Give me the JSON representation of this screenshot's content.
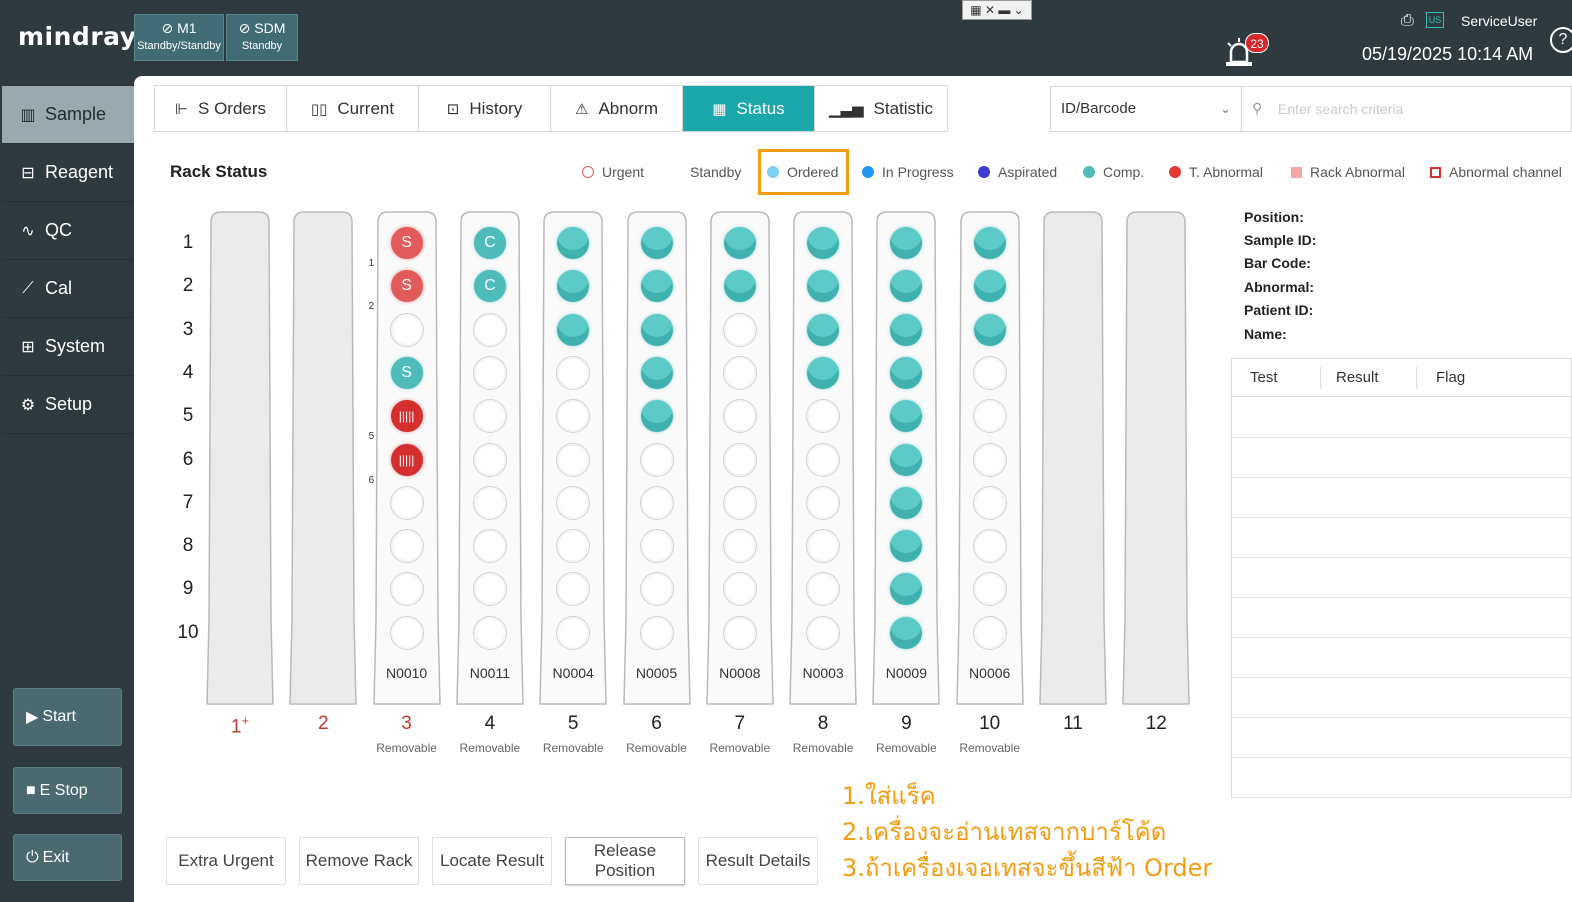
{
  "brand": "mindray",
  "modules": [
    {
      "name": "M1",
      "state": "Standby/Standby"
    },
    {
      "name": "SDM",
      "state": "Standby"
    }
  ],
  "header": {
    "alarm_count": "23",
    "lang_badge": "US",
    "user": "ServiceUser",
    "datetime": "05/19/2025 10:14 AM",
    "help": "?",
    "mini_toolbar": "▦ ✕ ▬ ⌄"
  },
  "sidebar": {
    "items": [
      {
        "label": "Sample",
        "icon": "sample-tubes-icon",
        "active": true
      },
      {
        "label": "Reagent",
        "icon": "reagent-bottle-icon"
      },
      {
        "label": "QC",
        "icon": "qc-chart-icon"
      },
      {
        "label": "Cal",
        "icon": "calibration-icon"
      },
      {
        "label": "System",
        "icon": "system-icon"
      },
      {
        "label": "Setup",
        "icon": "gear-icon"
      }
    ],
    "start": "Start",
    "estop": "E Stop",
    "exit": "Exit"
  },
  "tabs": [
    {
      "label": "S Orders",
      "icon": "sample-order-icon"
    },
    {
      "label": "Current",
      "icon": "tubes-icon"
    },
    {
      "label": "History",
      "icon": "history-icon"
    },
    {
      "label": "Abnorm",
      "icon": "warning-icon"
    },
    {
      "label": "Status",
      "icon": "rack-icon",
      "active": true
    },
    {
      "label": "Statistic",
      "icon": "bar-chart-icon"
    }
  ],
  "search": {
    "type_value": "ID/Barcode",
    "placeholder": "Enter search criteria"
  },
  "rack_status_title": "Rack Status",
  "legend": [
    {
      "label": "Urgent",
      "color": "#e35a5a",
      "style": "ring"
    },
    {
      "label": "Standby",
      "color": "#ffffff",
      "style": "none"
    },
    {
      "label": "Ordered",
      "color": "#7ecff2",
      "style": "dot"
    },
    {
      "label": "In Progress",
      "color": "#2196f3",
      "style": "dot"
    },
    {
      "label": "Aspirated",
      "color": "#3b3bd1",
      "style": "dot"
    },
    {
      "label": "Comp.",
      "color": "#4fbcbc",
      "style": "dot"
    },
    {
      "label": "T. Abnormal",
      "color": "#e53935",
      "style": "dot"
    },
    {
      "label": "Rack Abnormal",
      "color": "#f4a7a7",
      "style": "square"
    },
    {
      "label": "Abnormal channel",
      "color": "#d32f2f",
      "style": "square-ring"
    }
  ],
  "row_labels": [
    "1",
    "2",
    "3",
    "4",
    "5",
    "6",
    "7",
    "8",
    "9",
    "10"
  ],
  "racks": [
    {
      "num": "1",
      "sup": "+",
      "red": true,
      "id": "",
      "state": "",
      "empty": true,
      "slots": []
    },
    {
      "num": "2",
      "red": true,
      "id": "",
      "state": "",
      "empty": true,
      "slots": []
    },
    {
      "num": "3",
      "red": true,
      "id": "N0010",
      "state": "Removable",
      "slots": [
        {
          "type": "sred",
          "text": "S",
          "mark": "1"
        },
        {
          "type": "sred",
          "text": "S",
          "mark": "2"
        },
        {
          "type": "empty"
        },
        {
          "type": "steal",
          "text": "S"
        },
        {
          "type": "bar",
          "text": "|||||",
          "mark": "5"
        },
        {
          "type": "bar",
          "text": "|||||",
          "mark": "6"
        },
        {
          "type": "empty"
        },
        {
          "type": "empty"
        },
        {
          "type": "empty"
        },
        {
          "type": "empty"
        }
      ]
    },
    {
      "num": "4",
      "id": "N0011",
      "state": "Removable",
      "slots": [
        {
          "type": "steal",
          "text": "C"
        },
        {
          "type": "steal",
          "text": "C"
        },
        {
          "type": "empty"
        },
        {
          "type": "empty"
        },
        {
          "type": "empty"
        },
        {
          "type": "empty"
        },
        {
          "type": "empty"
        },
        {
          "type": "empty"
        },
        {
          "type": "empty"
        },
        {
          "type": "empty"
        }
      ]
    },
    {
      "num": "5",
      "id": "N0004",
      "state": "Removable",
      "comp": 3
    },
    {
      "num": "6",
      "id": "N0005",
      "state": "Removable",
      "comp": 5
    },
    {
      "num": "7",
      "id": "N0008",
      "state": "Removable",
      "comp": 2
    },
    {
      "num": "8",
      "id": "N0003",
      "state": "Removable",
      "comp": 4
    },
    {
      "num": "9",
      "id": "N0009",
      "state": "Removable",
      "comp": 10
    },
    {
      "num": "10",
      "id": "N0006",
      "state": "Removable",
      "comp": 3
    },
    {
      "num": "11",
      "id": "",
      "state": "",
      "empty": true,
      "slots": []
    },
    {
      "num": "12",
      "id": "",
      "state": "",
      "empty": true,
      "slots": []
    }
  ],
  "info": {
    "position": "Position:",
    "sample_id": "Sample ID:",
    "bar_code": "Bar Code:",
    "abnormal": "Abnormal:",
    "patient_id": "Patient ID:",
    "name": "Name:"
  },
  "result_table": {
    "columns": [
      "Test",
      "Result",
      "Flag"
    ],
    "rows": 10
  },
  "buttons": {
    "extra_urgent": "Extra Urgent",
    "remove_rack": "Remove Rack",
    "locate_result": "Locate Result",
    "release_position_1": "Release",
    "release_position_2": "Position",
    "result_details": "Result Details"
  },
  "notes": [
    "1.ใส่แร็ค",
    "2.เครื่องจะอ่านเทสจากบาร์โค้ด",
    "3.ถ้าเครื่องเจอเทสจะขึ้นสีฟ้า Order"
  ]
}
